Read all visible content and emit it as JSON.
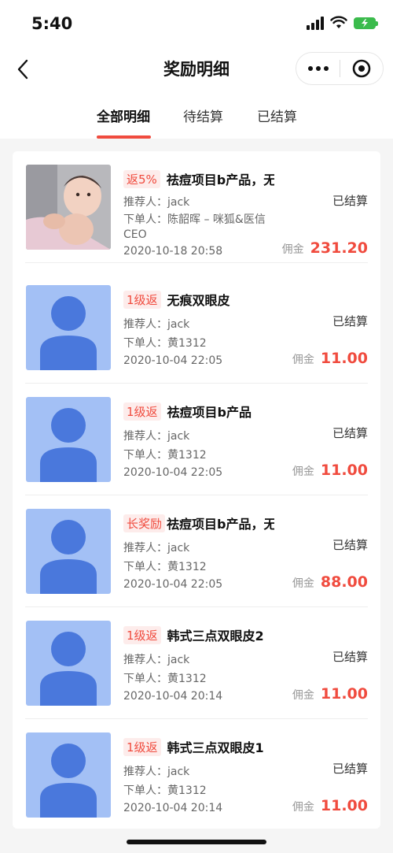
{
  "status_bar": {
    "time": "5:40"
  },
  "nav": {
    "title": "奖励明细"
  },
  "tabs": [
    {
      "label": "全部明细",
      "active": true
    },
    {
      "label": "待结算",
      "active": false
    },
    {
      "label": "已结算",
      "active": false
    }
  ],
  "colors": {
    "accent": "#f04b3e",
    "tag_bg": "#fdeceb",
    "avatar_bg": "#a3c0f5",
    "avatar_fg": "#4a78dc",
    "battery": "#3bbb4c"
  },
  "items": [
    {
      "tag": "返5%",
      "product": "祛痘项目b产品，无痕",
      "referrer": "推荐人：jack",
      "buyer": "下单人：陈韶晖 – 咪狐&医信",
      "buyer_cont": "CEO",
      "time": "2020-10-18 20:58",
      "status": "已结算",
      "commission_label": "佣金",
      "amount": "231.20",
      "thumb": "photo"
    },
    {
      "tag": "1级返",
      "product": "无痕双眼皮",
      "referrer": "推荐人：jack",
      "buyer": "下单人：黄1312",
      "time": "2020-10-04 22:05",
      "status": "已结算",
      "commission_label": "佣金",
      "amount": "11.00",
      "thumb": "avatar"
    },
    {
      "tag": "1级返",
      "product": "祛痘项目b产品",
      "referrer": "推荐人：jack",
      "buyer": "下单人：黄1312",
      "time": "2020-10-04 22:05",
      "status": "已结算",
      "commission_label": "佣金",
      "amount": "11.00",
      "thumb": "avatar"
    },
    {
      "tag": "长奖励",
      "product": "祛痘项目b产品，无痕",
      "referrer": "推荐人：jack",
      "buyer": "下单人：黄1312",
      "time": "2020-10-04 22:05",
      "status": "已结算",
      "commission_label": "佣金",
      "amount": "88.00",
      "thumb": "avatar"
    },
    {
      "tag": "1级返",
      "product": "韩式三点双眼皮2",
      "referrer": "推荐人：jack",
      "buyer": "下单人：黄1312",
      "time": "2020-10-04 20:14",
      "status": "已结算",
      "commission_label": "佣金",
      "amount": "11.00",
      "thumb": "avatar"
    },
    {
      "tag": "1级返",
      "product": "韩式三点双眼皮1",
      "referrer": "推荐人：jack",
      "buyer": "下单人：黄1312",
      "time": "2020-10-04 20:14",
      "status": "已结算",
      "commission_label": "佣金",
      "amount": "11.00",
      "thumb": "avatar"
    }
  ]
}
